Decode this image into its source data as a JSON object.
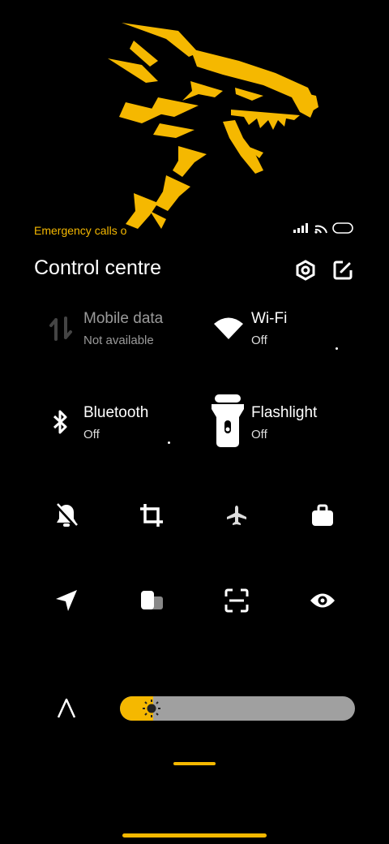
{
  "status": {
    "text": "Emergency calls o",
    "icons": [
      "signal-icon",
      "wifi-status-icon",
      "battery-icon"
    ]
  },
  "header": {
    "title": "Control centre",
    "settings_icon": "settings-hex-icon",
    "edit_icon": "edit-icon"
  },
  "tiles": [
    {
      "label": "Mobile data",
      "sub": "Not available",
      "icon": "mobile-data-icon",
      "state": "unavailable"
    },
    {
      "label": "Wi-Fi",
      "sub": "Off",
      "icon": "wifi-icon",
      "state": "off"
    },
    {
      "label": "Bluetooth",
      "sub": "Off",
      "icon": "bluetooth-icon",
      "state": "off"
    },
    {
      "label": "Flashlight",
      "sub": "Off",
      "icon": "flashlight-icon",
      "state": "off"
    }
  ],
  "quick_toggles": [
    "mute-icon",
    "crop-icon",
    "airplane-icon",
    "briefcase-icon",
    "location-icon",
    "theme-icon",
    "scan-icon",
    "eye-icon"
  ],
  "brightness": {
    "auto_icon": "auto-brightness-icon",
    "sun_icon": "sun-icon",
    "level": 0.14
  },
  "colors": {
    "accent": "#f5b800",
    "background": "#000000",
    "slider_track": "#a0a0a0",
    "dim_text": "#9a9a9a"
  }
}
